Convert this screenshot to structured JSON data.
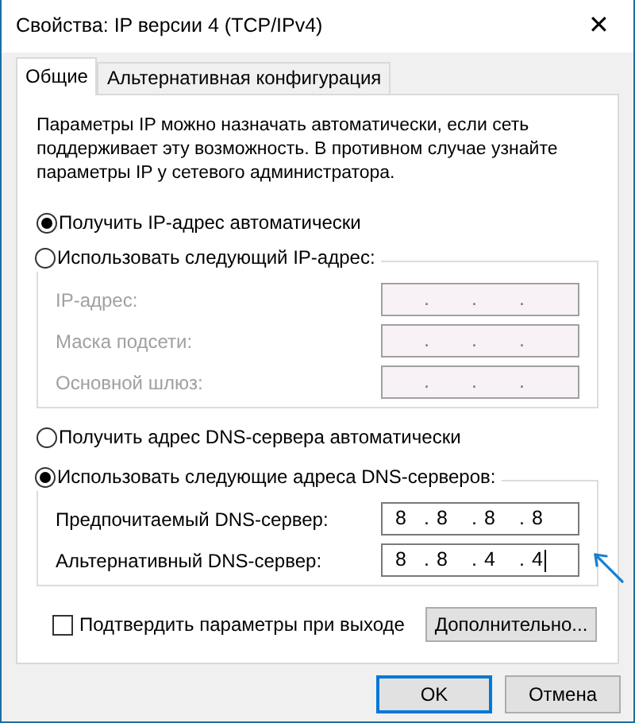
{
  "window": {
    "title": "Свойства: IP версии 4 (TCP/IPv4)",
    "close": "✕"
  },
  "tabs": [
    {
      "label": "Общие",
      "selected": true
    },
    {
      "label": "Альтернативная конфигурация",
      "selected": false
    }
  ],
  "description": "Параметры IP можно назначать автоматически, если сеть поддерживает эту возможность. В противном случае узнайте параметры IP у сетевого администратора.",
  "ip_auto": {
    "label": "Получить IP-адрес автоматически",
    "selected": true
  },
  "ip_manual": {
    "label": "Использовать следующий IP-адрес:",
    "selected": false,
    "fields": [
      {
        "label": "IP-адрес:",
        "disabled": true,
        "parts": [
          ".",
          ".",
          "."
        ]
      },
      {
        "label": "Маска подсети:",
        "disabled": true,
        "parts": [
          ".",
          ".",
          "."
        ]
      },
      {
        "label": "Основной шлюз:",
        "disabled": true,
        "parts": [
          ".",
          ".",
          "."
        ]
      }
    ]
  },
  "dns_auto": {
    "label": "Получить адрес DNS-сервера автоматически",
    "selected": false
  },
  "dns_manual": {
    "label": "Использовать следующие адреса DNS-серверов:",
    "selected": true,
    "fields": [
      {
        "label": "Предпочитаемый DNS-сервер:",
        "disabled": false,
        "focused": false,
        "parts": [
          "8",
          ".",
          "8",
          ".",
          "8",
          ".",
          "8"
        ]
      },
      {
        "label": "Альтернативный DNS-сервер:",
        "disabled": false,
        "focused": true,
        "parts": [
          "8",
          ".",
          "8",
          ".",
          "4",
          ".",
          "4"
        ]
      }
    ]
  },
  "validate": {
    "label": "Подтвердить параметры при выходе",
    "checked": false
  },
  "advanced_button": "Дополнительно...",
  "buttons": [
    {
      "label": "OK",
      "default": true
    },
    {
      "label": "Отмена",
      "default": false
    }
  ]
}
